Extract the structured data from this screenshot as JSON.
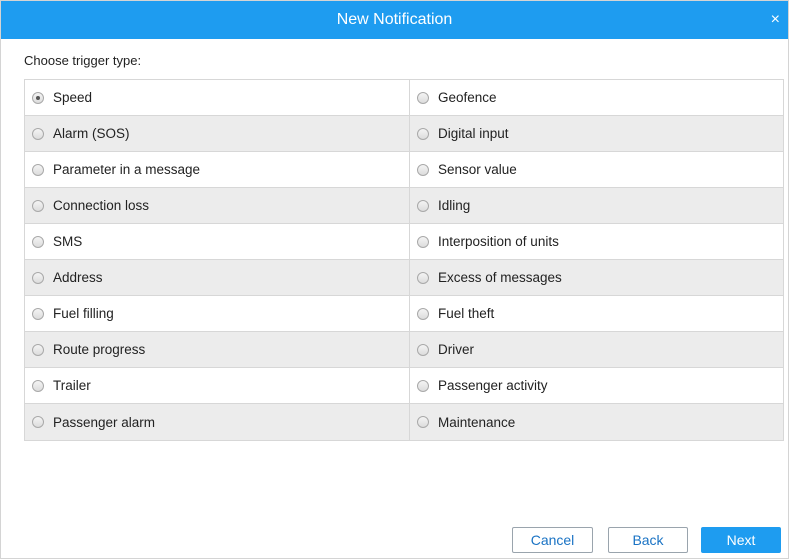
{
  "dialog": {
    "title": "New Notification",
    "close_label": "×"
  },
  "prompt": "Choose trigger type:",
  "triggers": [
    {
      "left": "Speed",
      "right": "Geofence"
    },
    {
      "left": "Alarm (SOS)",
      "right": "Digital input"
    },
    {
      "left": "Parameter in a message",
      "right": "Sensor value"
    },
    {
      "left": "Connection loss",
      "right": "Idling"
    },
    {
      "left": "SMS",
      "right": "Interposition of units"
    },
    {
      "left": "Address",
      "right": "Excess of messages"
    },
    {
      "left": "Fuel filling",
      "right": "Fuel theft"
    },
    {
      "left": "Route progress",
      "right": "Driver"
    },
    {
      "left": "Trailer",
      "right": "Passenger activity"
    },
    {
      "left": "Passenger alarm",
      "right": "Maintenance"
    }
  ],
  "selected": "Speed",
  "buttons": {
    "cancel": "Cancel",
    "back": "Back",
    "next": "Next"
  },
  "colors": {
    "accent": "#1e9cf0",
    "alt_row": "#ececec"
  }
}
